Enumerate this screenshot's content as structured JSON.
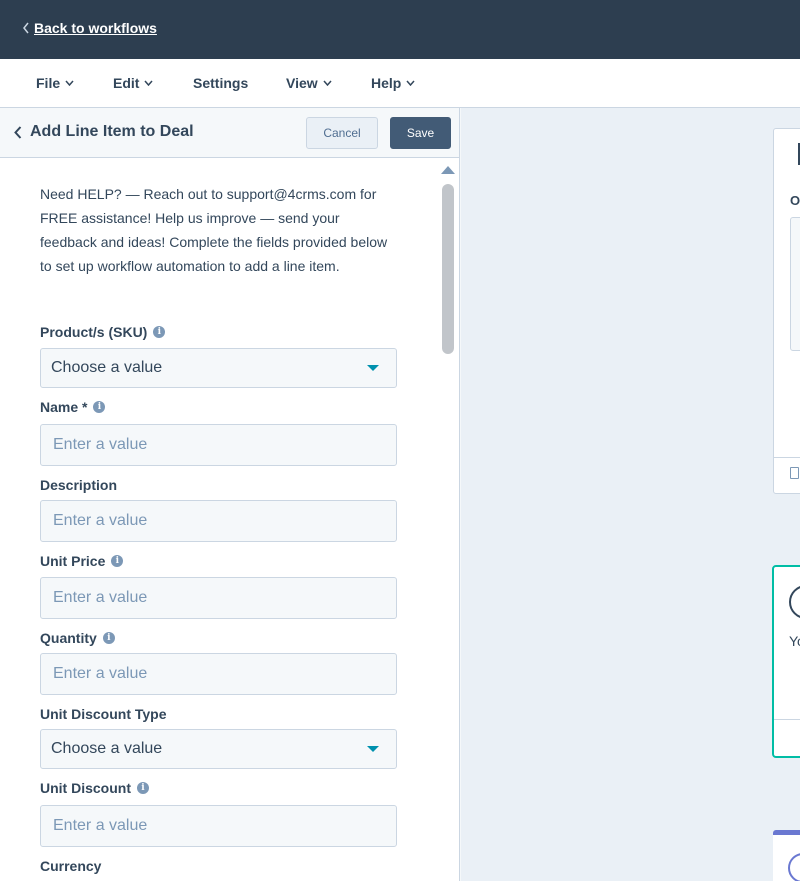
{
  "topbar": {
    "back_label": "Back to workflows"
  },
  "menu": [
    {
      "label": "File",
      "has_dropdown": true
    },
    {
      "label": "Edit",
      "has_dropdown": true
    },
    {
      "label": "Settings",
      "has_dropdown": false
    },
    {
      "label": "View",
      "has_dropdown": true
    },
    {
      "label": "Help",
      "has_dropdown": true
    }
  ],
  "panel": {
    "title": "Add Line Item to Deal",
    "cancel_label": "Cancel",
    "save_label": "Save",
    "intro": "Need HELP? — Reach out to support@4crms.com for FREE assistance! Help us improve — send your feedback and ideas! Complete the fields provided below to set up workflow automation to add a line item.",
    "fields": [
      {
        "label": "Product/s (SKU)",
        "type": "select",
        "info": true,
        "value": "Choose a value"
      },
      {
        "label": "Name *",
        "type": "input",
        "info": true,
        "placeholder": "Enter a value"
      },
      {
        "label": "Description",
        "type": "input",
        "info": false,
        "placeholder": "Enter a value"
      },
      {
        "label": "Unit Price",
        "type": "input",
        "info": true,
        "placeholder": "Enter a value"
      },
      {
        "label": "Quantity",
        "type": "input",
        "info": true,
        "placeholder": "Enter a value"
      },
      {
        "label": "Unit Discount Type",
        "type": "select",
        "info": false,
        "value": "Choose a value"
      },
      {
        "label": "Unit Discount",
        "type": "input",
        "info": true,
        "placeholder": "Enter a value"
      },
      {
        "label": "Currency",
        "type": "input",
        "info": false
      }
    ]
  },
  "canvas": {
    "card1_label": "O",
    "card2_text": "Yo"
  },
  "colors": {
    "topbar": "#2d3e50",
    "save_button": "#425b76",
    "accent_teal": "#00bda5",
    "caret": "#0091ae",
    "accent_purple": "#6a78d1"
  },
  "icons": {
    "back": "chevron-left-icon",
    "dropdown": "chevron-down-icon",
    "info": "info-icon",
    "select_caret": "caret-down-icon"
  }
}
